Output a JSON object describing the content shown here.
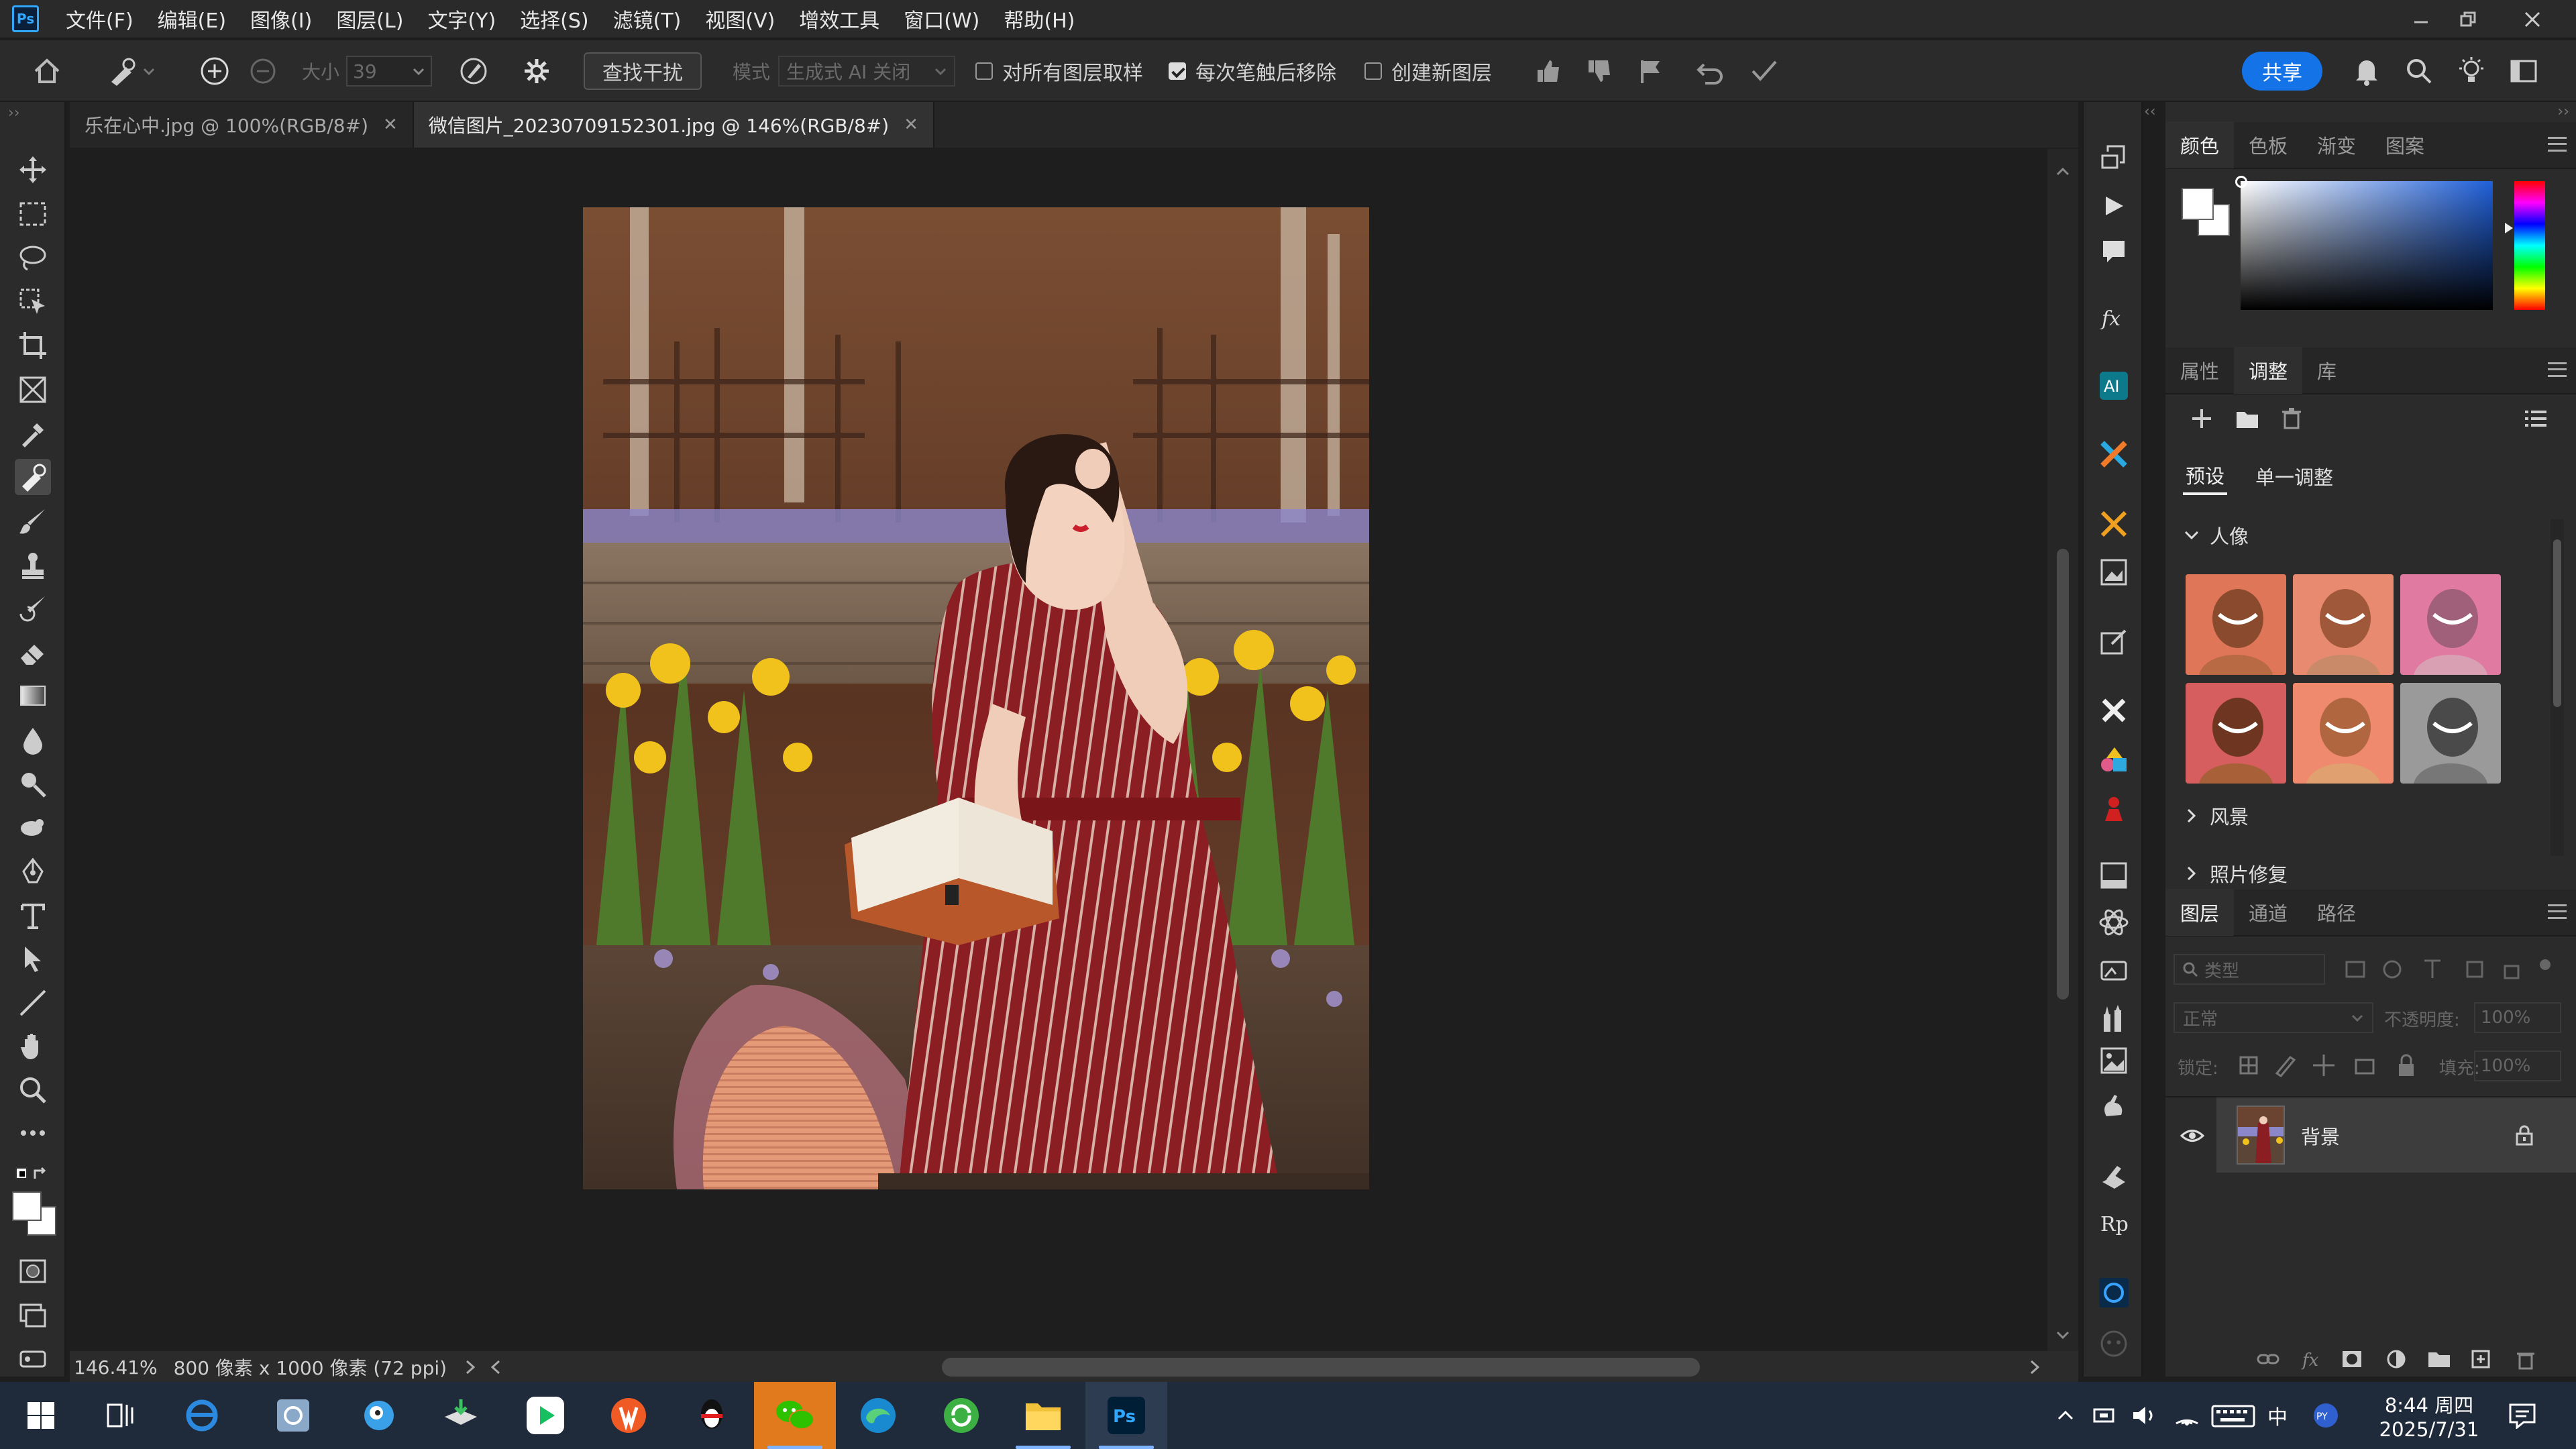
{
  "menubar": {
    "logo": "Ps",
    "items": [
      "文件(F)",
      "编辑(E)",
      "图像(I)",
      "图层(L)",
      "文字(Y)",
      "选择(S)",
      "滤镜(T)",
      "视图(V)",
      "增效工具",
      "窗口(W)",
      "帮助(H)"
    ]
  },
  "options": {
    "size_label": "大小",
    "size_value": "39",
    "find_distractions": "查找干扰",
    "mode_label": "模式",
    "mode_value": "生成式 AI 关闭",
    "sample_all_layers": "对所有图层取样",
    "sample_all_checked": false,
    "remove_after_stroke": "每次笔触后移除",
    "remove_after_checked": true,
    "create_new_layer": "创建新图层",
    "create_new_checked": false,
    "share": "共享"
  },
  "tabs": [
    {
      "label": "乐在心中.jpg @ 100%(RGB/8#)",
      "active": false
    },
    {
      "label": "微信图片_20230709152301.jpg @ 146%(RGB/8#)",
      "active": true
    }
  ],
  "status": {
    "zoom": "146.41%",
    "info": "800 像素 x 1000 像素 (72 ppi)"
  },
  "color_panel": {
    "tabs": [
      "颜色",
      "色板",
      "渐变",
      "图案"
    ],
    "active": 0
  },
  "adjust_panel": {
    "tabs": [
      "属性",
      "调整",
      "库"
    ],
    "active": 1,
    "subtabs": [
      "预设",
      "单一调整"
    ],
    "sections": [
      {
        "label": "人像",
        "expanded": true
      },
      {
        "label": "风景",
        "expanded": false
      },
      {
        "label": "照片修复",
        "expanded": false
      }
    ]
  },
  "layers_panel": {
    "tabs": [
      "图层",
      "通道",
      "路径"
    ],
    "active": 0,
    "filter_placeholder": "类型",
    "blend_mode": "正常",
    "opacity_label": "不透明度:",
    "opacity_value": "100%",
    "lock_label": "锁定:",
    "fill_label": "填充:",
    "fill_value": "100%",
    "layer_name": "背景"
  },
  "taskbar": {
    "time": "8:44 周四",
    "date": "2025/7/31",
    "ime": "中"
  },
  "colors": {
    "accent": "#1473e6",
    "ps_blue": "#31a8ff",
    "dress_red": "#8a1e22"
  }
}
